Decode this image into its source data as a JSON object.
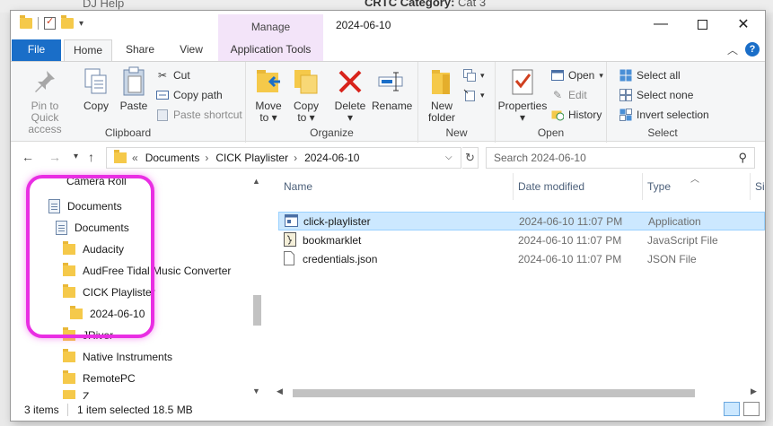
{
  "background": {
    "left_text": "DJ Help",
    "right_label": "CRTC Category:",
    "right_value": "Cat 3"
  },
  "titlebar": {
    "manage_tab": "Manage",
    "title": "2024-06-10"
  },
  "tabs": {
    "file": "File",
    "home": "Home",
    "share": "Share",
    "view": "View",
    "app_tools": "Application Tools",
    "help": "?"
  },
  "ribbon": {
    "clipboard": {
      "label": "Clipboard",
      "pin_line1": "Pin to Quick",
      "pin_line2": "access",
      "copy": "Copy",
      "paste": "Paste",
      "cut": "Cut",
      "copy_path": "Copy path",
      "paste_shortcut": "Paste shortcut"
    },
    "organize": {
      "label": "Organize",
      "move_line1": "Move",
      "move_line2": "to",
      "copy_line1": "Copy",
      "copy_line2": "to",
      "delete": "Delete",
      "rename": "Rename"
    },
    "new": {
      "label": "New",
      "new_folder_line1": "New",
      "new_folder_line2": "folder"
    },
    "open": {
      "label": "Open",
      "properties": "Properties",
      "open": "Open",
      "edit": "Edit",
      "history": "History"
    },
    "select": {
      "label": "Select",
      "select_all": "Select all",
      "select_none": "Select none",
      "invert": "Invert selection"
    }
  },
  "address": {
    "crumbs": [
      "Documents",
      "CICK Playlister",
      "2024-06-10"
    ],
    "search_placeholder": "Search 2024-06-10"
  },
  "tree": [
    "Camera Roll",
    "Documents",
    "Documents",
    "Audacity",
    "AudFree Tidal Music Converter",
    "CICK Playlister",
    "2024-06-10",
    "JRiver",
    "Native Instruments",
    "RemotePC",
    "Z"
  ],
  "columns": {
    "name": "Name",
    "date": "Date modified",
    "type": "Type",
    "size": "Si"
  },
  "files": [
    {
      "name": "click-playlister",
      "date": "2024-06-10 11:07 PM",
      "type": "Application",
      "icon": "application-icon"
    },
    {
      "name": "bookmarklet",
      "date": "2024-06-10 11:07 PM",
      "type": "JavaScript File",
      "icon": "javascript-file-icon"
    },
    {
      "name": "credentials.json",
      "date": "2024-06-10 11:07 PM",
      "type": "JSON File",
      "icon": "json-file-icon"
    }
  ],
  "status": {
    "items": "3 items",
    "selected": "1 item selected",
    "size": "18.5 MB"
  },
  "colors": {
    "accent": "#1a6ec8",
    "selection": "#cce8ff",
    "annotation": "#e92ee3",
    "manage_tab": "#f3e4f9"
  }
}
